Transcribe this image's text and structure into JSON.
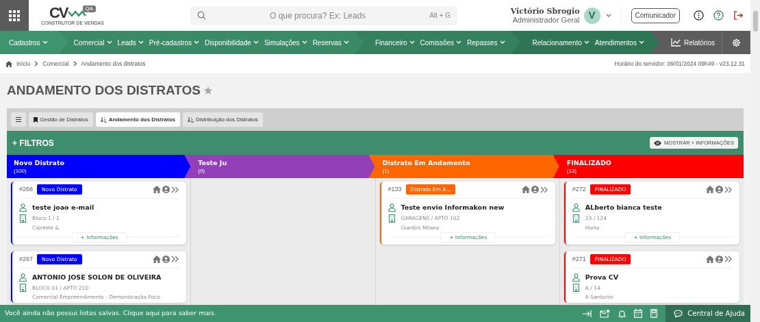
{
  "header": {
    "logo": {
      "mark": "CV",
      "tag": "QA",
      "tagline": "CONSTRUTOR DE VENDAS"
    },
    "search": {
      "placeholder": "O que procura? Ex: Leads",
      "shortcut": "Alt + G"
    },
    "user": {
      "name": "Victório Sbrogio",
      "role": "Administrador Geral",
      "initial": "V"
    },
    "communicator_button": "Comunicador"
  },
  "nav": {
    "groups": [
      {
        "items": [
          "Cadastros"
        ]
      },
      {
        "items": [
          "Comercial",
          "Leads",
          "Pré-cadastros",
          "Disponibilidade",
          "Simulações",
          "Reservas"
        ]
      },
      {
        "items": [
          "Financeiro",
          "Comissões",
          "Repasses"
        ]
      },
      {
        "items": [
          "Relacionamento",
          "Atendimentos"
        ]
      }
    ],
    "reports": "Relatórios"
  },
  "breadcrumb": [
    "Início",
    "Comercial",
    "Andamento dos distratos"
  ],
  "server_time": "Horário do servidor: 09/01/2024 09h49 - v23.12.31",
  "page": {
    "title": "ANDAMENTO DOS DISTRATOS",
    "favorite": false
  },
  "tabs": [
    {
      "label": "Gestão de Distratos",
      "selected": false
    },
    {
      "label": "Andamento dos Distratos",
      "selected": true
    },
    {
      "label": "Distribuição dos Distratos",
      "selected": false
    }
  ],
  "filters": {
    "label": "+ FILTROS",
    "more_button": "MOSTRAR + INFORMAÇÕES"
  },
  "columns": [
    {
      "title": "Novo Distrato",
      "count": "(100)",
      "color": "#0000ff",
      "cards": [
        {
          "number": "#268",
          "status": "Novo Distrato",
          "name": "teste joao e-mail",
          "unit": "Bloco 1 / 1",
          "enterprise": "Cipreste &",
          "more": "+ Informações"
        },
        {
          "number": "#267",
          "status": "Novo Distrato",
          "name": "ANTONIO JOSE SOLON DE OLIVEIRA",
          "unit": "BLOCO 01 / APTO 210",
          "enterprise": "Comercial Empreendimento - Demonstração Foco"
        }
      ]
    },
    {
      "title": "Teste Ju",
      "count": "(0)",
      "color": "#9340b8"
    },
    {
      "title": "Distrato Em Andamento",
      "count": "(1)",
      "color": "#ff6600",
      "cards": [
        {
          "number": "#133",
          "status": "Distrato Em A...",
          "name": "Teste envio Informakon new",
          "unit": "GARAGENS / APTO 102",
          "enterprise": "Giardini Milano",
          "more": "+ Informações"
        }
      ]
    },
    {
      "title": "FINALIZADO",
      "count": "(13)",
      "color": "#ff0000",
      "cards": [
        {
          "number": "#272",
          "status": "FINALIZADO",
          "name": "ALberto bianca teste",
          "unit": "23 / 124",
          "enterprise": "Horto",
          "more": "+ Informações"
        },
        {
          "number": "#271",
          "status": "FINALIZADO",
          "name": "Prova CV",
          "unit": "A / 14",
          "enterprise": "A Santorini"
        }
      ]
    }
  ],
  "footer": {
    "message": "Você ainda não possui listas salvas. Clique aqui para saber mais.",
    "help": "Central de Ajuda"
  }
}
